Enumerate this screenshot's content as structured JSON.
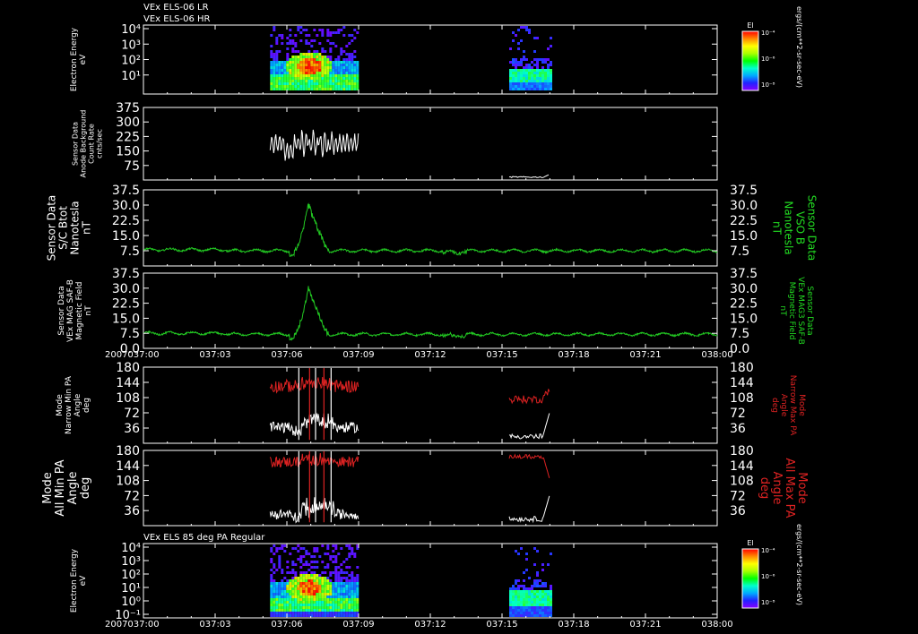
{
  "header": {
    "line1": "VEx ELS-06 LR",
    "line2": "VEx ELS-06 HR",
    "bottom_title": "VEx ELS 85 deg PA Regular"
  },
  "colorbar": {
    "title": "El",
    "ticks": [
      "10⁻⁴",
      "10⁻⁶",
      "10⁻⁸"
    ],
    "unit": "ergs/(cm**2-sr-sec-eV)"
  },
  "time_axis": {
    "year": "2007",
    "ticks": [
      "037:00",
      "037:03",
      "037:06",
      "037:09",
      "037:12",
      "037:15",
      "037:18",
      "037:21",
      "038:00"
    ]
  },
  "colors": {
    "background": "#000000",
    "axis": "#ffffff",
    "green_series": "#22c822",
    "green_label": "#22dd22",
    "red_series": "#dd2222",
    "white_series": "#ffffff"
  },
  "chart_data": [
    {
      "type": "heatmap",
      "ylabel": [
        "Electron Energy",
        "eV"
      ],
      "yscale": "log",
      "ytick_labels": [
        "10⁴",
        "10³",
        "10²",
        "10¹"
      ],
      "segments": [
        {
          "x_start": "037:05.3",
          "x_end": "037:09.0"
        },
        {
          "x_start": "037:15.3",
          "x_end": "037:17.0"
        }
      ]
    },
    {
      "type": "line",
      "ylabel": [
        "Sensor Data",
        "Anode Background",
        "Count Rate",
        "cnts/sec"
      ],
      "ylim": [
        0,
        375
      ],
      "yticks": [
        "375",
        "300",
        "225",
        "150",
        "75"
      ],
      "series": [
        {
          "color": "#ffffff",
          "segment": [
            "037:05.3",
            "037:09.0"
          ],
          "range": [
            100,
            280
          ]
        },
        {
          "color": "#ffffff",
          "segment": [
            "037:15.3",
            "037:17.0"
          ],
          "range": [
            0,
            35
          ]
        }
      ]
    },
    {
      "type": "line",
      "ylabel": [
        "Sensor Data",
        "S/C Btot",
        "Nanotesla",
        "nT"
      ],
      "rlabel": [
        "Sensor Data",
        "VSO B",
        "Nanotesla",
        "nT"
      ],
      "ylim": [
        0,
        37.5
      ],
      "yticks": [
        "37.5",
        "30.0",
        "22.5",
        "15.0",
        "7.5"
      ],
      "series": [
        {
          "color": "#22c822",
          "baseline": 7.5,
          "peak": 31,
          "peak_time": "037:06.9"
        }
      ]
    },
    {
      "type": "line",
      "ylabel": [
        "Sensor Data",
        "VEx MAG SAF-B",
        "Magnetic Field",
        "nT"
      ],
      "rlabel": [
        "Sensor Data",
        "VEx MAG3 SAF-B",
        "Magnetic Field",
        "nT"
      ],
      "ylim": [
        0,
        37.5
      ],
      "yticks": [
        "37.5",
        "30.0",
        "22.5",
        "15.0",
        "7.5",
        "0.0"
      ],
      "series": [
        {
          "color": "#22c822",
          "baseline": 7.0,
          "peak": 31,
          "peak_time": "037:06.9"
        }
      ]
    },
    {
      "type": "line",
      "ylabel": [
        "Mode",
        "Narrow Min PA",
        "Angle",
        "deg"
      ],
      "rlabel": [
        "Mode",
        "Narrow Max PA",
        "Angle",
        "deg"
      ],
      "ylim": [
        0,
        180
      ],
      "yticks": [
        "180",
        "144",
        "108",
        "72",
        "36"
      ],
      "series": [
        {
          "name": "min",
          "color": "#ffffff"
        },
        {
          "name": "max",
          "color": "#dd2222"
        }
      ]
    },
    {
      "type": "line",
      "ylabel": [
        "Mode",
        "All Min PA",
        "Angle",
        "deg"
      ],
      "rlabel": [
        "Mode",
        "All Max PA",
        "Angle",
        "deg"
      ],
      "ylim": [
        0,
        180
      ],
      "yticks": [
        "180",
        "144",
        "108",
        "72",
        "36"
      ],
      "series": [
        {
          "name": "min",
          "color": "#ffffff"
        },
        {
          "name": "max",
          "color": "#dd2222"
        }
      ]
    },
    {
      "type": "heatmap",
      "ylabel": [
        "Electron Energy",
        "eV"
      ],
      "yscale": "log",
      "ytick_labels": [
        "10⁴",
        "10³",
        "10²",
        "10¹",
        "10⁰",
        "10⁻¹"
      ],
      "segments": [
        {
          "x_start": "037:05.3",
          "x_end": "037:09.0"
        },
        {
          "x_start": "037:15.3",
          "x_end": "037:17.0"
        }
      ]
    }
  ]
}
